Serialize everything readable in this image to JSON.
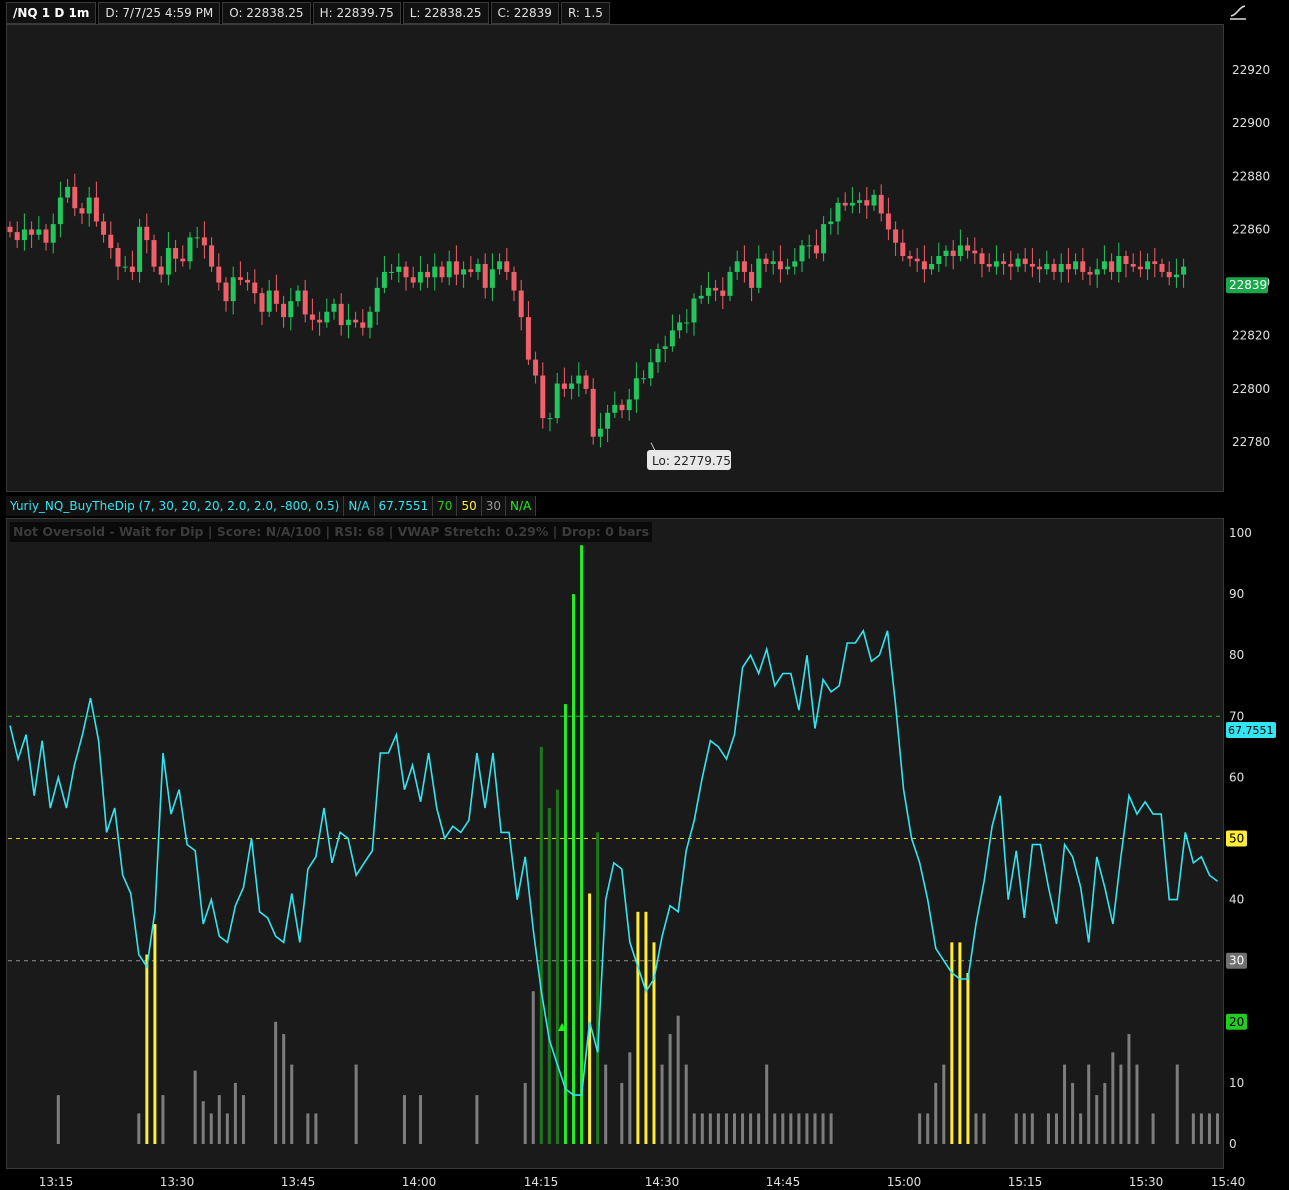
{
  "header": {
    "symbol": "/NQ 1 D 1m",
    "date": "D: 7/7/25 4:59 PM",
    "open": "O: 22838.25",
    "high": "H: 22839.75",
    "low": "L: 22838.25",
    "close": "C: 22839",
    "range": "R: 1.5"
  },
  "indicator_header": {
    "name": "Yuriy_NQ_BuyTheDip (7, 30, 20, 20, 2.0, 2.0, -800, 0.5)",
    "v1": "N/A",
    "v2": "67.7551",
    "v3": "70",
    "v4": "50",
    "v5": "30",
    "v6": "N/A"
  },
  "status_label": "Not Oversold - Wait for Dip | Score: N/A/100 | RSI: 68 | VWAP Stretch: 0.29% | Drop: 0 bars",
  "low_callout": "Lo: 22779.75",
  "last_price": "22839",
  "rsi_last": "67.7551",
  "colors": {
    "up": "#22c55e",
    "down": "#f0606a",
    "rsi": "#33e5f0",
    "yellow": "#ffee33",
    "gray": "#7d7d7d",
    "bright_green": "#22ee22",
    "dark_green": "#1a7a1a",
    "green_line": "#22bb22",
    "yellow_line": "#e0d020"
  },
  "chart_data": [
    {
      "type": "candlestick",
      "title": "/NQ 1 D 1m",
      "ylim": [
        22764,
        22940
      ],
      "y_ticks": [
        "22780",
        "22800",
        "22820",
        "22840",
        "22860",
        "22880",
        "22900",
        "22920"
      ],
      "x_ticks": [
        "13:15",
        "13:30",
        "13:45",
        "14:00",
        "14:15",
        "14:30",
        "14:45",
        "15:00",
        "15:15",
        "15:30",
        "15:40"
      ],
      "close_series": [
        22859,
        22856,
        22860,
        22858,
        22860,
        22855,
        22862,
        22872,
        22876,
        22868,
        22866,
        22872,
        22863,
        22858,
        22853,
        22846,
        22846,
        22844,
        22861,
        22856,
        22846,
        22843,
        22853,
        22849,
        22848,
        22857,
        22857,
        22854,
        22846,
        22840,
        22833,
        22842,
        22841,
        22840,
        22836,
        22829,
        22837,
        22832,
        22827,
        22833,
        22837,
        22828,
        22826,
        22825,
        22829,
        22832,
        22824,
        22826,
        22825,
        22823,
        22829,
        22838,
        22844,
        22844,
        22846,
        22842,
        22840,
        22844,
        22842,
        22846,
        22842,
        22848,
        22843,
        22845,
        22844,
        22847,
        22838,
        22845,
        22848,
        22844,
        22837,
        22827,
        22811,
        22805,
        22789,
        22789,
        22802,
        22800,
        22802,
        22805,
        22800,
        22782,
        22785,
        22791,
        22794,
        22792,
        22796,
        22804,
        22804,
        22810,
        22815,
        22816,
        22822,
        22825,
        22825,
        22834,
        22835,
        22838,
        22837,
        22835,
        22844,
        22848,
        22844,
        22838,
        22849,
        22847,
        22848,
        22845,
        22846,
        22848,
        22854,
        22854,
        22851,
        22862,
        22863,
        22870,
        22869,
        22870,
        22871,
        22869,
        22873,
        22866,
        22860,
        22855,
        22850,
        22849,
        22848,
        22845,
        22847,
        22850,
        22852,
        22850,
        22854,
        22852,
        22851,
        22847,
        22846,
        22848,
        22847,
        22846,
        22849,
        22847,
        22846,
        22845,
        22847,
        22844,
        22847,
        22845,
        22848,
        22844,
        22843,
        22845,
        22848,
        22844,
        22850,
        22847,
        22846,
        22845,
        22848,
        22847,
        22844,
        22842,
        22843,
        22846
      ]
    },
    {
      "type": "line+bar",
      "title": "Yuriy_NQ_BuyTheDip (7, 30, 20, 20, 2.0, 2.0, -800, 0.5)",
      "ylim": [
        0,
        100
      ],
      "y_ticks": [
        "0",
        "10",
        "20",
        "30",
        "40",
        "50",
        "60",
        "70",
        "80",
        "90",
        "100"
      ],
      "reference_lines": [
        70,
        50,
        30
      ],
      "rsi_x_minutes": [
        0,
        1,
        2,
        3,
        4,
        5,
        6,
        7,
        8,
        9,
        10,
        11,
        12,
        13,
        14,
        15,
        16,
        17,
        18,
        19,
        20,
        21,
        22,
        23,
        24,
        25,
        26,
        27,
        28,
        29,
        30,
        31,
        32,
        33,
        34,
        35,
        36,
        37,
        38,
        39,
        40,
        41,
        42,
        43,
        44,
        45,
        46,
        47,
        48,
        49,
        50,
        51,
        52,
        53,
        54,
        55,
        56,
        57,
        58,
        59,
        60,
        61,
        62,
        63,
        64,
        65,
        66,
        67,
        68,
        69,
        70,
        71,
        72,
        73,
        74,
        75,
        76,
        77,
        78,
        79,
        80,
        81,
        82,
        83,
        84,
        85,
        86,
        87,
        88,
        89,
        90,
        91,
        92,
        93,
        94,
        95,
        96,
        97,
        98,
        99,
        100,
        101,
        102,
        103,
        104,
        105,
        106,
        107,
        108,
        109,
        110,
        111,
        112,
        113,
        114,
        115,
        116,
        117,
        118,
        119,
        120,
        121,
        122,
        123,
        124,
        125,
        126,
        127,
        128,
        129,
        130,
        131,
        132,
        133,
        134,
        135,
        136,
        137,
        138,
        139,
        140,
        141,
        142,
        143,
        144,
        145,
        146,
        147,
        148,
        149,
        150
      ],
      "rsi_values": [
        68.5,
        63,
        67,
        57,
        66,
        55,
        60,
        55,
        62,
        67,
        73,
        66,
        51,
        55,
        44,
        41,
        31,
        29,
        38,
        64,
        54,
        58,
        49,
        48,
        36,
        40,
        34,
        33,
        39,
        42,
        50,
        38,
        37,
        34,
        33,
        41,
        33,
        45,
        47,
        55,
        46,
        51,
        50,
        44,
        46,
        48,
        64,
        64,
        67,
        58,
        62,
        56,
        64,
        55,
        50,
        52,
        51,
        53,
        64,
        55,
        64,
        51,
        51,
        40,
        47,
        35,
        25,
        17,
        13,
        9,
        8,
        8,
        20,
        15,
        40,
        46,
        45,
        33,
        29,
        25,
        27,
        34,
        39,
        38,
        48,
        53,
        60,
        66,
        65,
        63,
        67,
        78,
        80,
        77,
        81,
        75,
        77,
        77,
        71,
        80,
        68,
        76,
        74,
        75,
        82,
        82,
        84,
        79,
        80,
        84,
        72,
        58,
        50,
        46,
        40,
        32,
        30,
        28,
        27,
        27,
        36,
        43,
        52,
        57,
        40,
        48,
        37,
        49,
        49,
        42,
        36,
        49,
        47,
        42,
        33,
        47,
        42,
        36,
        47,
        57,
        54,
        56,
        54,
        54,
        40,
        40,
        51,
        46,
        47,
        44,
        43
      ],
      "bars": [
        {
          "x": 6,
          "v": 8,
          "c": "gray"
        },
        {
          "x": 16,
          "v": 5,
          "c": "gray"
        },
        {
          "x": 17,
          "v": 31,
          "c": "yellow"
        },
        {
          "x": 18,
          "v": 36,
          "c": "yellow"
        },
        {
          "x": 19,
          "v": 8,
          "c": "gray"
        },
        {
          "x": 23,
          "v": 12,
          "c": "gray"
        },
        {
          "x": 24,
          "v": 7,
          "c": "gray"
        },
        {
          "x": 25,
          "v": 5,
          "c": "gray"
        },
        {
          "x": 26,
          "v": 8,
          "c": "gray"
        },
        {
          "x": 27,
          "v": 5,
          "c": "gray"
        },
        {
          "x": 28,
          "v": 10,
          "c": "gray"
        },
        {
          "x": 29,
          "v": 8,
          "c": "gray"
        },
        {
          "x": 33,
          "v": 20,
          "c": "gray"
        },
        {
          "x": 34,
          "v": 18,
          "c": "gray"
        },
        {
          "x": 35,
          "v": 13,
          "c": "gray"
        },
        {
          "x": 37,
          "v": 5,
          "c": "gray"
        },
        {
          "x": 38,
          "v": 5,
          "c": "gray"
        },
        {
          "x": 43,
          "v": 13,
          "c": "gray"
        },
        {
          "x": 49,
          "v": 8,
          "c": "gray"
        },
        {
          "x": 51,
          "v": 8,
          "c": "gray"
        },
        {
          "x": 58,
          "v": 8,
          "c": "gray"
        },
        {
          "x": 64,
          "v": 10,
          "c": "gray"
        },
        {
          "x": 65,
          "v": 25,
          "c": "gray"
        },
        {
          "x": 66,
          "v": 65,
          "c": "dark_green"
        },
        {
          "x": 67,
          "v": 55,
          "c": "dark_green"
        },
        {
          "x": 68,
          "v": 58,
          "c": "dark_green"
        },
        {
          "x": 69,
          "v": 72,
          "c": "bright_green"
        },
        {
          "x": 70,
          "v": 90,
          "c": "bright_green"
        },
        {
          "x": 71,
          "v": 98,
          "c": "bright_green"
        },
        {
          "x": 72,
          "v": 41,
          "c": "yellow"
        },
        {
          "x": 73,
          "v": 51,
          "c": "dark_green"
        },
        {
          "x": 74,
          "v": 13,
          "c": "gray"
        },
        {
          "x": 76,
          "v": 10,
          "c": "gray"
        },
        {
          "x": 77,
          "v": 15,
          "c": "gray"
        },
        {
          "x": 78,
          "v": 38,
          "c": "yellow"
        },
        {
          "x": 79,
          "v": 38,
          "c": "yellow"
        },
        {
          "x": 80,
          "v": 33,
          "c": "yellow"
        },
        {
          "x": 81,
          "v": 13,
          "c": "gray"
        },
        {
          "x": 82,
          "v": 18,
          "c": "gray"
        },
        {
          "x": 83,
          "v": 21,
          "c": "gray"
        },
        {
          "x": 84,
          "v": 13,
          "c": "gray"
        },
        {
          "x": 85,
          "v": 5,
          "c": "gray"
        },
        {
          "x": 86,
          "v": 5,
          "c": "gray"
        },
        {
          "x": 87,
          "v": 5,
          "c": "gray"
        },
        {
          "x": 88,
          "v": 5,
          "c": "gray"
        },
        {
          "x": 89,
          "v": 5,
          "c": "gray"
        },
        {
          "x": 90,
          "v": 5,
          "c": "gray"
        },
        {
          "x": 91,
          "v": 5,
          "c": "gray"
        },
        {
          "x": 92,
          "v": 5,
          "c": "gray"
        },
        {
          "x": 93,
          "v": 5,
          "c": "gray"
        },
        {
          "x": 94,
          "v": 13,
          "c": "gray"
        },
        {
          "x": 95,
          "v": 5,
          "c": "gray"
        },
        {
          "x": 96,
          "v": 5,
          "c": "gray"
        },
        {
          "x": 97,
          "v": 5,
          "c": "gray"
        },
        {
          "x": 98,
          "v": 5,
          "c": "gray"
        },
        {
          "x": 99,
          "v": 5,
          "c": "gray"
        },
        {
          "x": 100,
          "v": 5,
          "c": "gray"
        },
        {
          "x": 101,
          "v": 5,
          "c": "gray"
        },
        {
          "x": 102,
          "v": 5,
          "c": "gray"
        },
        {
          "x": 113,
          "v": 5,
          "c": "gray"
        },
        {
          "x": 114,
          "v": 5,
          "c": "gray"
        },
        {
          "x": 115,
          "v": 10,
          "c": "gray"
        },
        {
          "x": 116,
          "v": 13,
          "c": "gray"
        },
        {
          "x": 117,
          "v": 33,
          "c": "yellow"
        },
        {
          "x": 118,
          "v": 33,
          "c": "yellow"
        },
        {
          "x": 119,
          "v": 28,
          "c": "yellow"
        },
        {
          "x": 120,
          "v": 5,
          "c": "gray"
        },
        {
          "x": 121,
          "v": 5,
          "c": "gray"
        },
        {
          "x": 125,
          "v": 5,
          "c": "gray"
        },
        {
          "x": 126,
          "v": 5,
          "c": "gray"
        },
        {
          "x": 127,
          "v": 5,
          "c": "gray"
        },
        {
          "x": 129,
          "v": 5,
          "c": "gray"
        },
        {
          "x": 130,
          "v": 5,
          "c": "gray"
        },
        {
          "x": 131,
          "v": 13,
          "c": "gray"
        },
        {
          "x": 132,
          "v": 10,
          "c": "gray"
        },
        {
          "x": 133,
          "v": 5,
          "c": "gray"
        },
        {
          "x": 134,
          "v": 13,
          "c": "gray"
        },
        {
          "x": 135,
          "v": 8,
          "c": "gray"
        },
        {
          "x": 136,
          "v": 10,
          "c": "gray"
        },
        {
          "x": 137,
          "v": 15,
          "c": "gray"
        },
        {
          "x": 138,
          "v": 13,
          "c": "gray"
        },
        {
          "x": 139,
          "v": 18,
          "c": "gray"
        },
        {
          "x": 140,
          "v": 13,
          "c": "gray"
        },
        {
          "x": 142,
          "v": 5,
          "c": "gray"
        },
        {
          "x": 145,
          "v": 13,
          "c": "gray"
        },
        {
          "x": 147,
          "v": 5,
          "c": "gray"
        },
        {
          "x": 148,
          "v": 5,
          "c": "gray"
        },
        {
          "x": 149,
          "v": 5,
          "c": "gray"
        },
        {
          "x": 150,
          "v": 5,
          "c": "gray"
        }
      ]
    }
  ]
}
